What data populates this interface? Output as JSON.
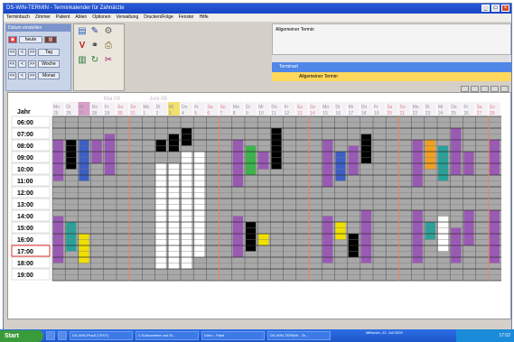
{
  "window": {
    "title": "DS-WIN-TERMIN - Terminkalender für Zahnärzte"
  },
  "menu": [
    "Terminbuch",
    "Zimmer",
    "Patient",
    "Ablen",
    "Optionen",
    "Verwaltung",
    "Drucken/Folge",
    "Fenster",
    "Hilfe"
  ],
  "nav_panel": {
    "title": "Datum einstellen",
    "heute": "heute",
    "back2": "<<",
    "back1": "<",
    "fwd": ">>",
    "tag": "Tag",
    "woche": "Woche",
    "monat": "Monat"
  },
  "right_top_text": "Allgemeiner Termin",
  "terminart": {
    "title": "Terminart",
    "item": "Allgemeiner Termin"
  },
  "calendar": {
    "month_labels": [
      "Mai 09",
      "Juni 09"
    ],
    "row_header": "Jahr",
    "days": [
      {
        "dow": "Mo",
        "num": "25"
      },
      {
        "dow": "Di",
        "num": "26"
      },
      {
        "dow": "Mi",
        "num": "27"
      },
      {
        "dow": "Do",
        "num": "28"
      },
      {
        "dow": "Fr",
        "num": "29"
      },
      {
        "dow": "Sa",
        "num": "30"
      },
      {
        "dow": "So",
        "num": "31"
      },
      {
        "dow": "Mo",
        "num": "1"
      },
      {
        "dow": "Di",
        "num": "2"
      },
      {
        "dow": "Mi",
        "num": "3"
      },
      {
        "dow": "Do",
        "num": "4"
      },
      {
        "dow": "Fr",
        "num": "5"
      },
      {
        "dow": "Sa",
        "num": "6"
      },
      {
        "dow": "So",
        "num": "7"
      },
      {
        "dow": "Mo",
        "num": "8"
      },
      {
        "dow": "Di",
        "num": "9"
      },
      {
        "dow": "Mi",
        "num": "10"
      },
      {
        "dow": "Do",
        "num": "11"
      },
      {
        "dow": "Fr",
        "num": "12"
      },
      {
        "dow": "Sa",
        "num": "13"
      },
      {
        "dow": "So",
        "num": "14"
      },
      {
        "dow": "Mo",
        "num": "15"
      },
      {
        "dow": "Di",
        "num": "16"
      },
      {
        "dow": "Mi",
        "num": "17"
      },
      {
        "dow": "Do",
        "num": "18"
      },
      {
        "dow": "Fr",
        "num": "19"
      },
      {
        "dow": "Sa",
        "num": "20"
      },
      {
        "dow": "So",
        "num": "21"
      },
      {
        "dow": "Mo",
        "num": "22"
      },
      {
        "dow": "Di",
        "num": "23"
      },
      {
        "dow": "Mi",
        "num": "24"
      },
      {
        "dow": "Do",
        "num": "25"
      },
      {
        "dow": "Fr",
        "num": "26"
      },
      {
        "dow": "Sa",
        "num": "27"
      },
      {
        "dow": "So",
        "num": "28"
      }
    ],
    "times": [
      "06:00",
      "07:00",
      "08:00",
      "09:00",
      "10:00",
      "11:00",
      "12:00",
      "13:00",
      "14:00",
      "15:00",
      "16:00",
      "17:00",
      "18:00",
      "19:00"
    ],
    "current_time": "17:00",
    "colors": {
      "purple": "#9b59b6",
      "blue": "#3d5fc4",
      "black": "#000000",
      "yellow": "#f0e000",
      "green": "#3cb44b",
      "teal": "#2aa198",
      "white": "#ffffff",
      "orange": "#f0a020",
      "pink": "#e06090",
      "gray": "#a8a8a8",
      "weekend_line": "#f08060"
    },
    "appointments": [
      {
        "day": 0,
        "start": "08:00",
        "end": "11:30",
        "color": "purple"
      },
      {
        "day": 1,
        "start": "08:00",
        "end": "10:30",
        "color": "black"
      },
      {
        "day": 2,
        "start": "08:00",
        "end": "11:30",
        "color": "blue"
      },
      {
        "day": 3,
        "start": "08:00",
        "end": "10:00",
        "color": "purple"
      },
      {
        "day": 4,
        "start": "07:30",
        "end": "11:00",
        "color": "purple"
      },
      {
        "day": 0,
        "start": "14:30",
        "end": "18:30",
        "color": "purple"
      },
      {
        "day": 1,
        "start": "15:00",
        "end": "17:30",
        "color": "teal"
      },
      {
        "day": 2,
        "start": "16:00",
        "end": "18:30",
        "color": "yellow"
      },
      {
        "day": 8,
        "start": "08:00",
        "end": "09:00",
        "color": "black"
      },
      {
        "day": 9,
        "start": "07:30",
        "end": "09:00",
        "color": "black"
      },
      {
        "day": 10,
        "start": "07:00",
        "end": "08:30",
        "color": "black"
      },
      {
        "day": 8,
        "start": "10:00",
        "end": "19:00",
        "color": "white"
      },
      {
        "day": 9,
        "start": "10:00",
        "end": "19:00",
        "color": "white"
      },
      {
        "day": 10,
        "start": "09:00",
        "end": "19:00",
        "color": "white"
      },
      {
        "day": 11,
        "start": "09:00",
        "end": "18:00",
        "color": "white"
      },
      {
        "day": 14,
        "start": "08:00",
        "end": "12:00",
        "color": "purple"
      },
      {
        "day": 15,
        "start": "08:30",
        "end": "11:00",
        "color": "green"
      },
      {
        "day": 16,
        "start": "09:00",
        "end": "10:30",
        "color": "purple"
      },
      {
        "day": 17,
        "start": "07:00",
        "end": "10:30",
        "color": "black"
      },
      {
        "day": 14,
        "start": "14:30",
        "end": "18:00",
        "color": "purple"
      },
      {
        "day": 15,
        "start": "15:00",
        "end": "17:30",
        "color": "black"
      },
      {
        "day": 16,
        "start": "16:00",
        "end": "17:00",
        "color": "yellow"
      },
      {
        "day": 21,
        "start": "08:00",
        "end": "12:00",
        "color": "purple"
      },
      {
        "day": 22,
        "start": "09:00",
        "end": "11:30",
        "color": "blue"
      },
      {
        "day": 23,
        "start": "08:30",
        "end": "11:00",
        "color": "purple"
      },
      {
        "day": 24,
        "start": "07:30",
        "end": "10:00",
        "color": "black"
      },
      {
        "day": 21,
        "start": "14:30",
        "end": "18:30",
        "color": "purple"
      },
      {
        "day": 22,
        "start": "15:00",
        "end": "16:30",
        "color": "yellow"
      },
      {
        "day": 23,
        "start": "16:00",
        "end": "18:00",
        "color": "black"
      },
      {
        "day": 24,
        "start": "14:00",
        "end": "18:30",
        "color": "purple"
      },
      {
        "day": 28,
        "start": "08:00",
        "end": "12:00",
        "color": "purple"
      },
      {
        "day": 29,
        "start": "08:00",
        "end": "10:30",
        "color": "orange"
      },
      {
        "day": 30,
        "start": "08:30",
        "end": "11:30",
        "color": "teal"
      },
      {
        "day": 31,
        "start": "07:00",
        "end": "11:00",
        "color": "purple"
      },
      {
        "day": 32,
        "start": "09:00",
        "end": "11:00",
        "color": "purple"
      },
      {
        "day": 28,
        "start": "14:00",
        "end": "18:30",
        "color": "purple"
      },
      {
        "day": 29,
        "start": "15:00",
        "end": "16:30",
        "color": "teal"
      },
      {
        "day": 30,
        "start": "14:30",
        "end": "17:30",
        "color": "white"
      },
      {
        "day": 31,
        "start": "15:30",
        "end": "18:30",
        "color": "purple"
      },
      {
        "day": 32,
        "start": "14:00",
        "end": "17:00",
        "color": "purple"
      },
      {
        "day": 34,
        "start": "08:00",
        "end": "11:00",
        "color": "purple"
      },
      {
        "day": 34,
        "start": "14:00",
        "end": "18:30",
        "color": "purple"
      }
    ]
  },
  "taskbar": {
    "start": "Start",
    "tasks": [
      "DS-WIN-Plus5 (TEST)",
      "C:\\Dokumente und Ei...",
      "Dünn - Paint",
      "DS-WIN-TERMIN - Te..."
    ],
    "date": "Mittwoch, 22. Juli 2009",
    "time": "17:02"
  }
}
